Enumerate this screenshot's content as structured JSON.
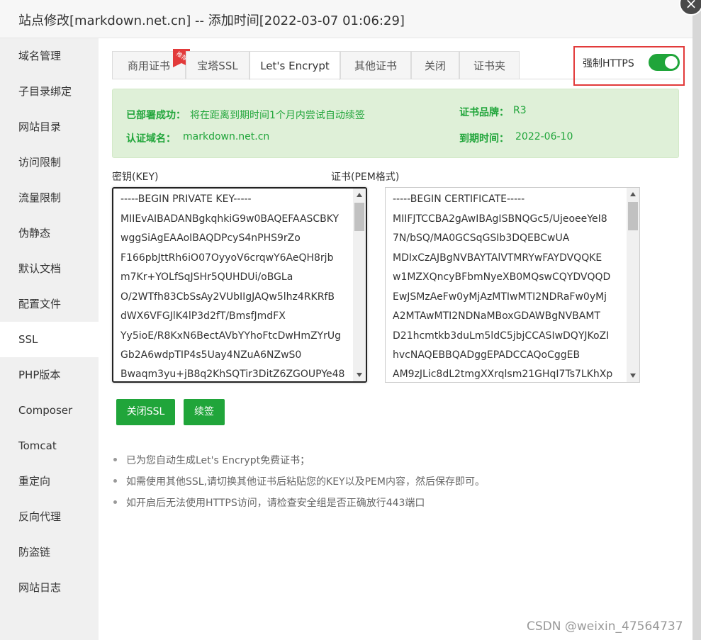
{
  "dialog": {
    "title": "站点修改[markdown.net.cn] -- 添加时间[2022-03-07 01:06:29]",
    "close_icon": "×"
  },
  "sidebar": {
    "items": [
      {
        "label": "域名管理"
      },
      {
        "label": "子目录绑定"
      },
      {
        "label": "网站目录"
      },
      {
        "label": "访问限制"
      },
      {
        "label": "流量限制"
      },
      {
        "label": "伪静态"
      },
      {
        "label": "默认文档"
      },
      {
        "label": "配置文件"
      },
      {
        "label": "SSL"
      },
      {
        "label": "PHP版本"
      },
      {
        "label": "Composer"
      },
      {
        "label": "Tomcat"
      },
      {
        "label": "重定向"
      },
      {
        "label": "反向代理"
      },
      {
        "label": "防盗链"
      },
      {
        "label": "网站日志"
      }
    ],
    "active": "SSL"
  },
  "tabs": [
    {
      "label": "商用证书"
    },
    {
      "label": "宝塔SSL"
    },
    {
      "label": "Let's Encrypt"
    },
    {
      "label": "其他证书"
    },
    {
      "label": "关闭"
    },
    {
      "label": "证书夹"
    }
  ],
  "ribbon_text": "推荐",
  "force_https": {
    "label": "强制HTTPS",
    "enabled": true
  },
  "status": {
    "deploy_label": "已部署成功：",
    "deploy_value": "将在距离到期时间1个月内尝试自动续签",
    "brand_label": "证书品牌：",
    "brand_value": "R3",
    "domain_label": "认证域名：",
    "domain_value": "markdown.net.cn",
    "expire_label": "到期时间：",
    "expire_value": "2022-06-10"
  },
  "key": {
    "label": "密钥(KEY)",
    "lines": [
      "-----BEGIN PRIVATE KEY-----",
      "MIIEvAIBADANBgkqhkiG9w0BAQEFAASCBKY",
      "wggSiAgEAAoIBAQDPcyS4nPHS9rZo",
      "F166pbJttRh6iO07OyyoV6crqwY6AeQH8rjb",
      "m7Kr+YOLfSqJSHr5QUHDUi/oBGLa",
      "O/2WTfh83CbSsAy2VUbIIgJAQw5lhz4RKRfB",
      "dWX6VFGJlK4lP3d2fT/BmsfJmdFX",
      "Yy5ioE/R8KxN6BectAVbYYhoFtcDwHmZYrUg",
      "Gb2A6wdpTIP4s5Uay4NZuA6NZwS0",
      "Bwaqm3yu+jB8q2KhSQTir3DitZ6ZGOUPYe48"
    ]
  },
  "cert": {
    "label": "证书(PEM格式)",
    "lines": [
      "-----BEGIN CERTIFICATE-----",
      "MIIFJTCCBA2gAwIBAgISBNQGc5/UjeoeeYeI8",
      "7N/bSQ/MA0GCSqGSIb3DQEBCwUA",
      "MDIxCzAJBgNVBAYTAlVTMRYwFAYDVQQKE",
      "w1MZXQncyBFbmNyeXB0MQswCQYDVQQD",
      "EwJSMzAeFw0yMjAzMTIwMTI2NDRaFw0yMj",
      "A2MTAwMTI2NDNaMBoxGDAWBgNVBAMT",
      "D21hcmtkb3duLm5ldC5jbjCCASIwDQYJKoZI",
      "hvcNAQEBBQADggEPADCCAQoCggEB",
      "AM9zJLic8dL2tmgXXrqlsm21GHqI7Ts7LKhXp"
    ]
  },
  "buttons": {
    "close_ssl": "关闭SSL",
    "renew": "续签"
  },
  "tips": [
    "已为您自动生成Let's Encrypt免费证书；",
    "如需使用其他SSL,请切换其他证书后粘贴您的KEY以及PEM内容，然后保存即可。",
    "如开启后无法使用HTTPS访问，请检查安全组是否正确放行443端口"
  ],
  "watermark": "CSDN @weixin_47564737",
  "colors": {
    "accent": "#20a53a",
    "highlight_border": "#e23a3a",
    "info_bg": "#dff0d8"
  }
}
